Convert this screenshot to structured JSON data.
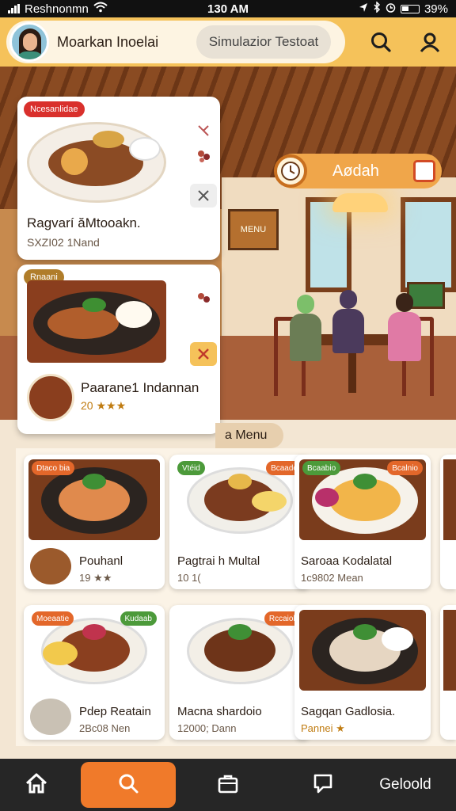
{
  "status_bar": {
    "carrier": "Reshnonmn",
    "time": "130 AM",
    "battery": "39%"
  },
  "header": {
    "user_name": "Moarkan Inoelai",
    "search_placeholder": "Simulazior Testoat"
  },
  "hero": {
    "time_label": "Aødah"
  },
  "featured": [
    {
      "tag": "Ncesanlidae",
      "title": "Ragvarí ăMtooakn.",
      "subtitle": "SXZI02 1Nand"
    },
    {
      "tag": "Rnaani",
      "title": "Paarane1 Indannan",
      "subtitle": "20 ★★★"
    }
  ],
  "menu_label": "a Menu",
  "grid": [
    {
      "badge": "Dtaco bia",
      "title": "Pouhanl",
      "meta": "19 ★★"
    },
    {
      "badge": "Vtéid",
      "badge2": "Bcaado",
      "title": "Pagtrai h Multal",
      "meta": "10 1("
    },
    {
      "badge": "Bcaabio",
      "badge2": "Bcalnio",
      "title": "Saroaa Kodalatal",
      "meta": "1c9802 Mean"
    },
    {
      "badge": "Moeaatie",
      "badge2": "Kudaab",
      "title": "Pdep Reatain",
      "meta": "2Bc08 Nen"
    },
    {
      "badge": "Rccaiob",
      "title": "Macna shardoio",
      "meta": "12000; Dann"
    },
    {
      "title": "Sagqan Gadlosia.",
      "meta": "Pannei ★"
    }
  ],
  "bottom_nav": {
    "label": "Geloold"
  },
  "colors": {
    "accent": "#f07a2a",
    "header": "#f5c25a",
    "nav": "#262626"
  }
}
